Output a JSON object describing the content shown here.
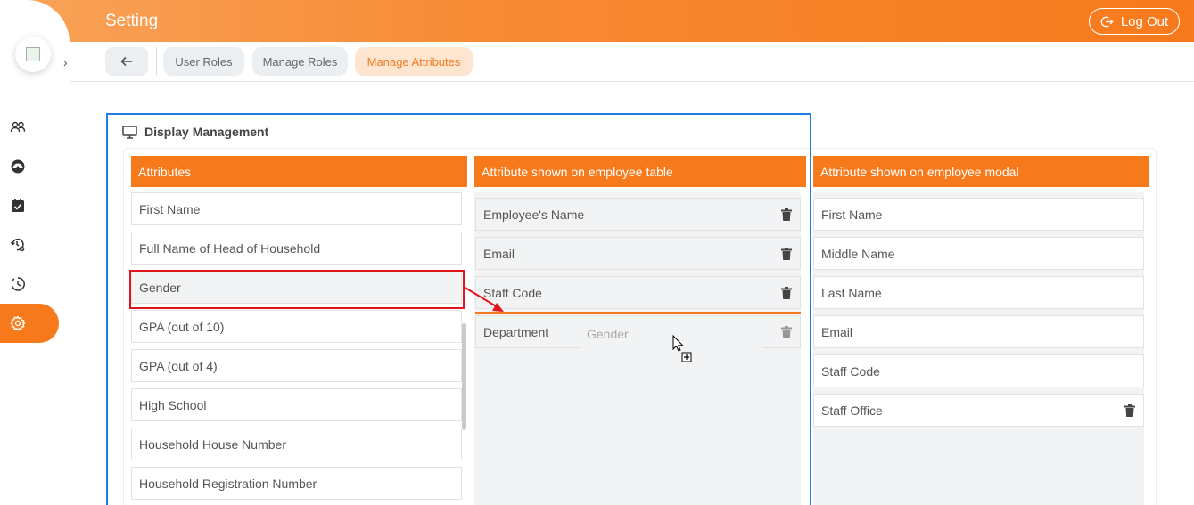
{
  "header": {
    "title": "Setting",
    "logout_label": "Log Out"
  },
  "sidebar": {
    "items": [
      {
        "icon": "users-icon"
      },
      {
        "icon": "dashboard-icon"
      },
      {
        "icon": "calendar-check-icon"
      },
      {
        "icon": "history-settings-icon"
      },
      {
        "icon": "clock-icon"
      },
      {
        "icon": "gear-icon",
        "active": true
      }
    ]
  },
  "tabs": [
    {
      "label": "User Roles",
      "active": false
    },
    {
      "label": "Manage Roles",
      "active": false
    },
    {
      "label": "Manage Attributes",
      "active": true
    }
  ],
  "panel": {
    "title": "Display Management",
    "columns": [
      {
        "header": "Attributes",
        "items": [
          "First Name",
          "Full Name of Head of Household",
          "Gender",
          "GPA (out of 10)",
          "GPA (out of 4)",
          "High School",
          "Household House Number",
          "Household Registration Number"
        ]
      },
      {
        "header": "Attribute shown on employee table",
        "items": [
          "Employee's Name",
          "Email",
          "Staff Code",
          "Department"
        ]
      },
      {
        "header": "Attribute shown on employee modal",
        "items": [
          "First Name",
          "Middle Name",
          "Last Name",
          "Email",
          "Staff Code",
          "Staff Office"
        ]
      }
    ],
    "drag_ghost": "Gender"
  },
  "colors": {
    "accent": "#f67a1c",
    "highlight_border": "#1f7fe0",
    "annotation": "#e0141c"
  }
}
